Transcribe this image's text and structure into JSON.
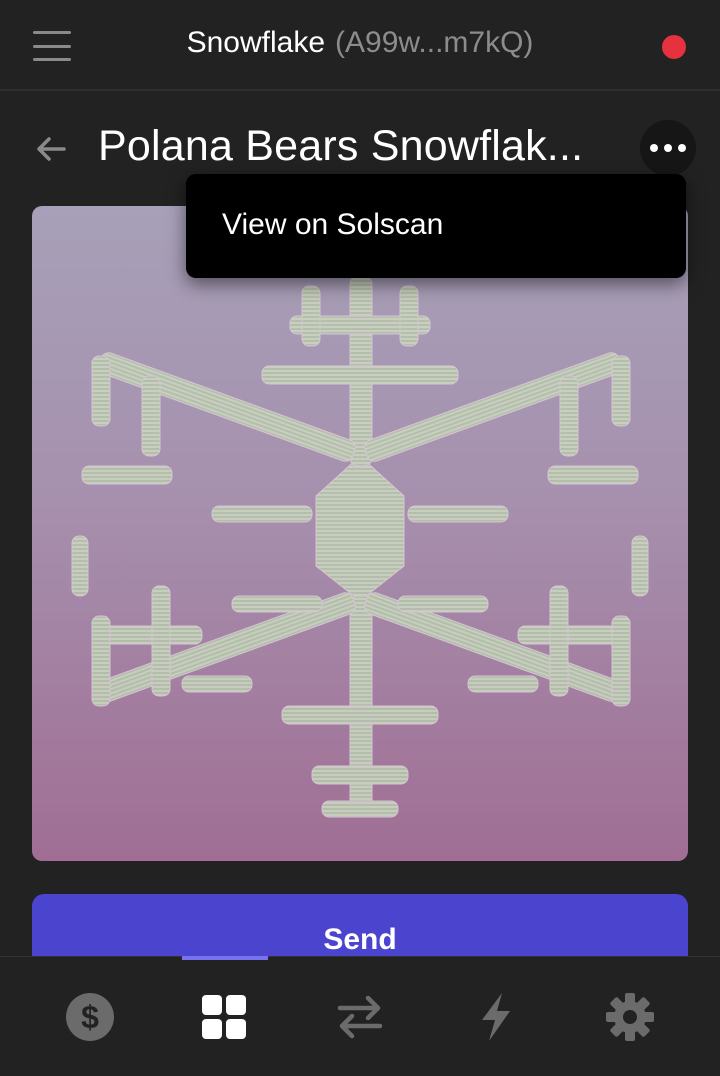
{
  "header": {
    "wallet_name": "Snowflake",
    "wallet_address": "(A99w...m7kQ)",
    "status_color": "#e6323e",
    "menu_icon": "hamburger-menu-icon"
  },
  "detail": {
    "back_icon": "back-arrow-icon",
    "title": "Polana Bears Snowflak...",
    "more_icon": "more-dots-icon",
    "image_desc_icon": "nft-image"
  },
  "menu": {
    "items": [
      {
        "label": "View on Solscan"
      }
    ]
  },
  "actions": {
    "send_label": "Send"
  },
  "tabbar": {
    "active_color": "#7a73f0",
    "tabs": [
      {
        "icon": "dollar-icon",
        "active": false
      },
      {
        "icon": "grid-icon",
        "active": true
      },
      {
        "icon": "swap-arrows-icon",
        "active": false
      },
      {
        "icon": "lightning-icon",
        "active": false
      },
      {
        "icon": "gear-icon",
        "active": false
      }
    ]
  },
  "colors": {
    "background": "#222222",
    "accent": "#4a44cf"
  }
}
